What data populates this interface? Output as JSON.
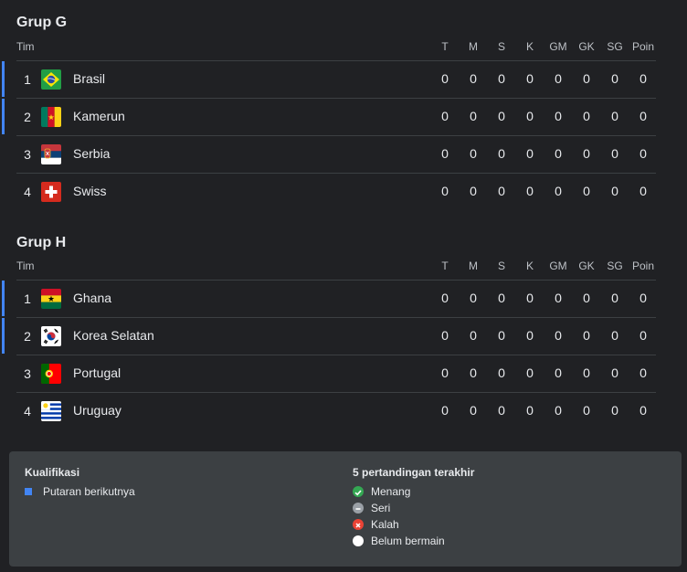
{
  "columns": [
    "T",
    "M",
    "S",
    "K",
    "GM",
    "GK",
    "SG",
    "Poin"
  ],
  "team_header": "Tim",
  "groups": [
    {
      "title": "Grup G",
      "teams": [
        {
          "pos": "1",
          "name": "Brasil",
          "flag": "brazil-flag-icon",
          "qualified": true,
          "stats": [
            "0",
            "0",
            "0",
            "0",
            "0",
            "0",
            "0",
            "0"
          ]
        },
        {
          "pos": "2",
          "name": "Kamerun",
          "flag": "cameroon-flag-icon",
          "qualified": true,
          "stats": [
            "0",
            "0",
            "0",
            "0",
            "0",
            "0",
            "0",
            "0"
          ]
        },
        {
          "pos": "3",
          "name": "Serbia",
          "flag": "serbia-flag-icon",
          "qualified": false,
          "stats": [
            "0",
            "0",
            "0",
            "0",
            "0",
            "0",
            "0",
            "0"
          ]
        },
        {
          "pos": "4",
          "name": "Swiss",
          "flag": "switzerland-flag-icon",
          "qualified": false,
          "stats": [
            "0",
            "0",
            "0",
            "0",
            "0",
            "0",
            "0",
            "0"
          ]
        }
      ]
    },
    {
      "title": "Grup H",
      "teams": [
        {
          "pos": "1",
          "name": "Ghana",
          "flag": "ghana-flag-icon",
          "qualified": true,
          "stats": [
            "0",
            "0",
            "0",
            "0",
            "0",
            "0",
            "0",
            "0"
          ]
        },
        {
          "pos": "2",
          "name": "Korea Selatan",
          "flag": "south-korea-flag-icon",
          "qualified": true,
          "stats": [
            "0",
            "0",
            "0",
            "0",
            "0",
            "0",
            "0",
            "0"
          ]
        },
        {
          "pos": "3",
          "name": "Portugal",
          "flag": "portugal-flag-icon",
          "qualified": false,
          "stats": [
            "0",
            "0",
            "0",
            "0",
            "0",
            "0",
            "0",
            "0"
          ]
        },
        {
          "pos": "4",
          "name": "Uruguay",
          "flag": "uruguay-flag-icon",
          "qualified": false,
          "stats": [
            "0",
            "0",
            "0",
            "0",
            "0",
            "0",
            "0",
            "0"
          ]
        }
      ]
    }
  ],
  "legend": {
    "qualification_title": "Kualifikasi",
    "qualification_item": "Putaran berikutnya",
    "last5_title": "5 pertandingan terakhir",
    "last5_items": [
      {
        "label": "Menang",
        "color": "#34a853",
        "icon": "check-icon"
      },
      {
        "label": "Seri",
        "color": "#9aa0a6",
        "icon": "minus-icon"
      },
      {
        "label": "Kalah",
        "color": "#ea4335",
        "icon": "close-icon"
      },
      {
        "label": "Belum bermain",
        "color": "#ffffff",
        "icon": "circle-icon"
      }
    ],
    "accent": "#4285f4"
  }
}
